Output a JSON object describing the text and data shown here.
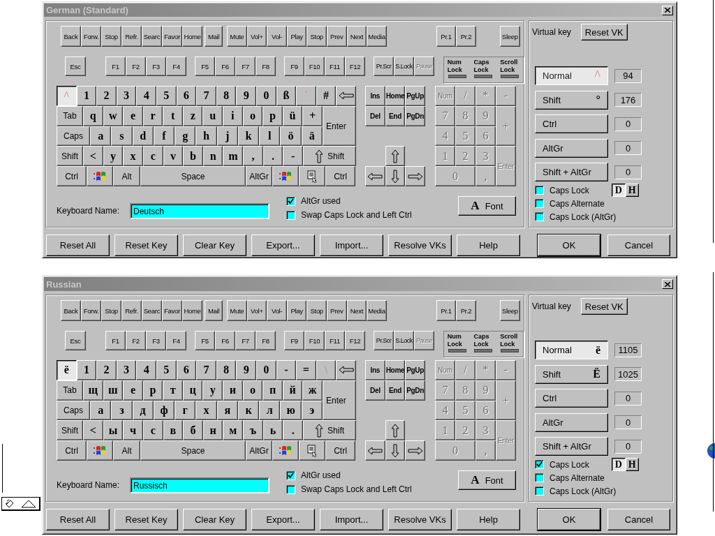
{
  "windows": [
    {
      "title": "German (Standard)",
      "media_keys": [
        [
          "Back",
          "Forw.",
          "Stop",
          "Refr.",
          "Searc",
          "Favor",
          "Home"
        ],
        [
          "Mail"
        ],
        [
          "Mute",
          "Vol+",
          "Vol-",
          "Play",
          "Stop",
          "Prev",
          "Next",
          "Media"
        ],
        [
          "Pr.1",
          "Pr.2"
        ],
        [
          "Sleep"
        ]
      ],
      "function_keys": [
        [
          "Esc"
        ],
        [
          "F1",
          "F2",
          "F3",
          "F4"
        ],
        [
          "F5",
          "F6",
          "F7",
          "F8"
        ],
        [
          "F9",
          "F10",
          "F11",
          "F12"
        ]
      ],
      "system_keys": [
        {
          "label": "Pr.Scr",
          "disabled": false
        },
        {
          "label": "S.Lock",
          "disabled": false
        },
        {
          "label": "Pause",
          "disabled": true
        }
      ],
      "lock_lights": [
        {
          "label": "Num Lock",
          "on": false
        },
        {
          "label": "Caps Lock",
          "on": false
        },
        {
          "label": "Scroll Lock",
          "on": false
        }
      ],
      "main_rows": [
        [
          {
            "label": "^",
            "kind": "dead",
            "selected": true
          },
          {
            "label": "1",
            "kind": "char",
            "selected": false
          },
          {
            "label": "2",
            "kind": "char",
            "selected": false
          },
          {
            "label": "3",
            "kind": "char",
            "selected": false
          },
          {
            "label": "4",
            "kind": "char",
            "selected": false
          },
          {
            "label": "5",
            "kind": "char",
            "selected": false
          },
          {
            "label": "6",
            "kind": "char",
            "selected": false
          },
          {
            "label": "7",
            "kind": "char",
            "selected": false
          },
          {
            "label": "8",
            "kind": "char",
            "selected": false
          },
          {
            "label": "9",
            "kind": "char",
            "selected": false
          },
          {
            "label": "0",
            "kind": "char",
            "selected": false
          },
          {
            "label": "ß",
            "kind": "char",
            "selected": false
          },
          {
            "label": "´",
            "kind": "dead",
            "selected": false
          },
          {
            "label": "#",
            "kind": "char",
            "selected": false
          },
          {
            "kind": "backspace",
            "selected": false
          }
        ],
        [
          {
            "label": "Tab",
            "kind": "tab",
            "selected": false
          },
          {
            "label": "q",
            "kind": "char",
            "selected": false
          },
          {
            "label": "w",
            "kind": "char",
            "selected": false
          },
          {
            "label": "e",
            "kind": "char",
            "selected": false
          },
          {
            "label": "r",
            "kind": "char",
            "selected": false
          },
          {
            "label": "t",
            "kind": "char",
            "selected": false
          },
          {
            "label": "z",
            "kind": "char",
            "selected": false
          },
          {
            "label": "u",
            "kind": "char",
            "selected": false
          },
          {
            "label": "i",
            "kind": "char",
            "selected": false
          },
          {
            "label": "o",
            "kind": "char",
            "selected": false
          },
          {
            "label": "p",
            "kind": "char",
            "selected": false
          },
          {
            "label": "ü",
            "kind": "char",
            "selected": false
          },
          {
            "label": "+",
            "kind": "char",
            "selected": false
          },
          {
            "label": "Enter",
            "kind": "enter",
            "selected": false
          }
        ],
        [
          {
            "label": "Caps",
            "kind": "caps",
            "selected": false
          },
          {
            "label": "a",
            "kind": "char",
            "selected": false
          },
          {
            "label": "s",
            "kind": "char",
            "selected": false
          },
          {
            "label": "d",
            "kind": "char",
            "selected": false
          },
          {
            "label": "f",
            "kind": "char",
            "selected": false
          },
          {
            "label": "g",
            "kind": "char",
            "selected": false
          },
          {
            "label": "h",
            "kind": "char",
            "selected": false
          },
          {
            "label": "j",
            "kind": "char",
            "selected": false
          },
          {
            "label": "k",
            "kind": "char",
            "selected": false
          },
          {
            "label": "l",
            "kind": "char",
            "selected": false
          },
          {
            "label": "ö",
            "kind": "char",
            "selected": false
          },
          {
            "label": "ä",
            "kind": "char",
            "selected": false
          }
        ],
        [
          {
            "label": "Shift",
            "kind": "shift",
            "selected": false
          },
          {
            "label": "<",
            "kind": "char",
            "selected": false
          },
          {
            "label": "y",
            "kind": "char",
            "selected": false
          },
          {
            "label": "x",
            "kind": "char",
            "selected": false
          },
          {
            "label": "c",
            "kind": "char",
            "selected": false
          },
          {
            "label": "v",
            "kind": "char",
            "selected": false
          },
          {
            "label": "b",
            "kind": "char",
            "selected": false
          },
          {
            "label": "n",
            "kind": "char",
            "selected": false
          },
          {
            "label": "m",
            "kind": "char",
            "selected": false
          },
          {
            "label": ",",
            "kind": "char",
            "selected": false
          },
          {
            "label": ".",
            "kind": "char",
            "selected": false
          },
          {
            "label": "-",
            "kind": "char",
            "selected": false
          },
          {
            "label": "Shift",
            "kind": "rshift",
            "selected": false
          }
        ],
        [
          {
            "label": "Ctrl",
            "kind": "ctrl",
            "selected": false
          },
          {
            "kind": "win",
            "selected": false
          },
          {
            "label": "Alt",
            "kind": "alt",
            "selected": false
          },
          {
            "label": "Space",
            "kind": "space",
            "selected": false
          },
          {
            "label": "AltGr",
            "kind": "altgr",
            "selected": false
          },
          {
            "kind": "win",
            "selected": false
          },
          {
            "kind": "menu",
            "selected": false
          },
          {
            "label": "Ctrl",
            "kind": "ctrl",
            "selected": false
          }
        ]
      ],
      "nav_keys": [
        "Ins",
        "Home",
        "PgUp",
        "Del",
        "End",
        "PgDn"
      ],
      "numpad": {
        "disabled": true,
        "keys": [
          "Num",
          "/",
          "*",
          "-",
          "7",
          "8",
          "9",
          "+",
          "4",
          "5",
          "6",
          "1",
          "2",
          "3",
          "Enter",
          "0",
          ","
        ]
      },
      "keyboard_name": {
        "label": "Keyboard Name:",
        "value": "Deutsch"
      },
      "options": [
        {
          "label": "AltGr used",
          "checked": true
        },
        {
          "label": "Swap Caps Lock and Left Ctrl",
          "checked": false
        }
      ],
      "font_button": {
        "icon": "A",
        "label": "Font"
      },
      "virtual_key": {
        "label": "Virtual key",
        "button": "Reset VK"
      },
      "shift_states": [
        {
          "label": "Normal",
          "char": "^",
          "code": "94",
          "selected": true,
          "dead": true
        },
        {
          "label": "Shift",
          "char": "°",
          "code": "176",
          "selected": false,
          "dead": false
        },
        {
          "label": "Ctrl",
          "code": "0",
          "selected": false
        },
        {
          "label": "AltGr",
          "code": "0",
          "selected": false
        },
        {
          "label": "Shift + AltGr",
          "code": "0",
          "selected": false
        }
      ],
      "caps_options": [
        {
          "label": "Caps Lock",
          "checked": false
        },
        {
          "label": "Caps Alternate",
          "checked": false
        },
        {
          "label": "Caps Lock (AltGr)",
          "checked": false
        }
      ],
      "display_toggle": [
        {
          "label": "D",
          "selected": true
        },
        {
          "label": "H",
          "selected": false
        }
      ],
      "buttons": [
        {
          "label": "Reset All",
          "default": false
        },
        {
          "label": "Reset Key",
          "default": false
        },
        {
          "label": "Clear Key",
          "default": false
        },
        {
          "label": "Export...",
          "default": false
        },
        {
          "label": "Import...",
          "default": false
        },
        {
          "label": "Resolve VKs",
          "default": false
        },
        {
          "label": "Help",
          "default": false
        }
      ],
      "dialog_buttons": [
        {
          "label": "OK",
          "default": true
        },
        {
          "label": "Cancel",
          "default": false
        }
      ]
    },
    {
      "title": "Russian",
      "media_keys": [
        [
          "Back",
          "Forw.",
          "Stop",
          "Refr.",
          "Searc",
          "Favor",
          "Home"
        ],
        [
          "Mail"
        ],
        [
          "Mute",
          "Vol+",
          "Vol-",
          "Play",
          "Stop",
          "Prev",
          "Next",
          "Media"
        ],
        [
          "Pr.1",
          "Pr.2"
        ],
        [
          "Sleep"
        ]
      ],
      "function_keys": [
        [
          "Esc"
        ],
        [
          "F1",
          "F2",
          "F3",
          "F4"
        ],
        [
          "F5",
          "F6",
          "F7",
          "F8"
        ],
        [
          "F9",
          "F10",
          "F11",
          "F12"
        ]
      ],
      "system_keys": [
        {
          "label": "Pr.Scr",
          "disabled": false
        },
        {
          "label": "S.Lock",
          "disabled": false
        },
        {
          "label": "Pause",
          "disabled": true
        }
      ],
      "lock_lights": [
        {
          "label": "Num Lock",
          "on": false
        },
        {
          "label": "Caps Lock",
          "on": false
        },
        {
          "label": "Scroll Lock",
          "on": false
        }
      ],
      "main_rows": [
        [
          {
            "label": "ё",
            "kind": "char",
            "selected": true
          },
          {
            "label": "1",
            "kind": "char",
            "selected": false
          },
          {
            "label": "2",
            "kind": "char",
            "selected": false
          },
          {
            "label": "3",
            "kind": "char",
            "selected": false
          },
          {
            "label": "4",
            "kind": "char",
            "selected": false
          },
          {
            "label": "5",
            "kind": "char",
            "selected": false
          },
          {
            "label": "6",
            "kind": "char",
            "selected": false
          },
          {
            "label": "7",
            "kind": "char",
            "selected": false
          },
          {
            "label": "8",
            "kind": "char",
            "selected": false
          },
          {
            "label": "9",
            "kind": "char",
            "selected": false
          },
          {
            "label": "0",
            "kind": "char",
            "selected": false
          },
          {
            "label": "-",
            "kind": "char",
            "selected": false
          },
          {
            "label": "=",
            "kind": "char",
            "selected": false
          },
          {
            "label": "\\",
            "kind": "dim",
            "selected": false
          },
          {
            "kind": "backspace",
            "selected": false
          }
        ],
        [
          {
            "label": "Tab",
            "kind": "tab",
            "selected": false
          },
          {
            "label": "щ",
            "kind": "char",
            "selected": false
          },
          {
            "label": "ш",
            "kind": "char",
            "selected": false
          },
          {
            "label": "е",
            "kind": "char",
            "selected": false
          },
          {
            "label": "р",
            "kind": "char",
            "selected": false
          },
          {
            "label": "т",
            "kind": "char",
            "selected": false
          },
          {
            "label": "ц",
            "kind": "char",
            "selected": false
          },
          {
            "label": "у",
            "kind": "char",
            "selected": false
          },
          {
            "label": "и",
            "kind": "char",
            "selected": false
          },
          {
            "label": "о",
            "kind": "char",
            "selected": false
          },
          {
            "label": "п",
            "kind": "char",
            "selected": false
          },
          {
            "label": "й",
            "kind": "char",
            "selected": false
          },
          {
            "label": "ж",
            "kind": "char",
            "selected": false
          },
          {
            "label": "Enter",
            "kind": "enter",
            "selected": false
          }
        ],
        [
          {
            "label": "Caps",
            "kind": "caps",
            "selected": false
          },
          {
            "label": "а",
            "kind": "char",
            "selected": false
          },
          {
            "label": "з",
            "kind": "char",
            "selected": false
          },
          {
            "label": "д",
            "kind": "char",
            "selected": false
          },
          {
            "label": "ф",
            "kind": "char",
            "selected": false
          },
          {
            "label": "г",
            "kind": "char",
            "selected": false
          },
          {
            "label": "х",
            "kind": "char",
            "selected": false
          },
          {
            "label": "я",
            "kind": "char",
            "selected": false
          },
          {
            "label": "к",
            "kind": "char",
            "selected": false
          },
          {
            "label": "л",
            "kind": "char",
            "selected": false
          },
          {
            "label": "ю",
            "kind": "char",
            "selected": false
          },
          {
            "label": "э",
            "kind": "char",
            "selected": false
          }
        ],
        [
          {
            "label": "Shift",
            "kind": "shift",
            "selected": false
          },
          {
            "label": "<",
            "kind": "char",
            "selected": false
          },
          {
            "label": "ы",
            "kind": "char",
            "selected": false
          },
          {
            "label": "ч",
            "kind": "char",
            "selected": false
          },
          {
            "label": "с",
            "kind": "char",
            "selected": false
          },
          {
            "label": "в",
            "kind": "char",
            "selected": false
          },
          {
            "label": "б",
            "kind": "char",
            "selected": false
          },
          {
            "label": "н",
            "kind": "char",
            "selected": false
          },
          {
            "label": "м",
            "kind": "char",
            "selected": false
          },
          {
            "label": "ъ",
            "kind": "char",
            "selected": false
          },
          {
            "label": "ь",
            "kind": "char",
            "selected": false
          },
          {
            "label": ".",
            "kind": "char",
            "selected": false
          },
          {
            "label": "Shift",
            "kind": "rshift",
            "selected": false
          }
        ],
        [
          {
            "label": "Ctrl",
            "kind": "ctrl",
            "selected": false
          },
          {
            "kind": "win",
            "selected": false
          },
          {
            "label": "Alt",
            "kind": "alt",
            "selected": false
          },
          {
            "label": "Space",
            "kind": "space",
            "selected": false
          },
          {
            "label": "AltGr",
            "kind": "altgr",
            "selected": false
          },
          {
            "kind": "win",
            "selected": false
          },
          {
            "kind": "menu",
            "selected": false
          },
          {
            "label": "Ctrl",
            "kind": "ctrl",
            "selected": false
          }
        ]
      ],
      "nav_keys": [
        "Ins",
        "Home",
        "PgUp",
        "Del",
        "End",
        "PgDn"
      ],
      "numpad": {
        "disabled": true,
        "keys": [
          "Num",
          "/",
          "*",
          "-",
          "7",
          "8",
          "9",
          "+",
          "4",
          "5",
          "6",
          "1",
          "2",
          "3",
          "Enter",
          "0",
          ","
        ]
      },
      "keyboard_name": {
        "label": "Keyboard Name:",
        "value": "Russisch"
      },
      "options": [
        {
          "label": "AltGr used",
          "checked": true
        },
        {
          "label": "Swap Caps Lock and Left Ctrl",
          "checked": false
        }
      ],
      "font_button": {
        "icon": "A",
        "label": "Font"
      },
      "virtual_key": {
        "label": "Virtual key",
        "button": "Reset VK"
      },
      "shift_states": [
        {
          "label": "Normal",
          "char": "ё",
          "code": "1105",
          "selected": true,
          "dead": false
        },
        {
          "label": "Shift",
          "char": "Ё",
          "code": "1025",
          "selected": false,
          "dead": false
        },
        {
          "label": "Ctrl",
          "code": "0",
          "selected": false
        },
        {
          "label": "AltGr",
          "code": "0",
          "selected": false
        },
        {
          "label": "Shift + AltGr",
          "code": "0",
          "selected": false
        }
      ],
      "caps_options": [
        {
          "label": "Caps Lock",
          "checked": true
        },
        {
          "label": "Caps Alternate",
          "checked": false
        },
        {
          "label": "Caps Lock (AltGr)",
          "checked": false
        }
      ],
      "display_toggle": [
        {
          "label": "D",
          "selected": true
        },
        {
          "label": "H",
          "selected": false
        }
      ],
      "buttons": [
        {
          "label": "Reset All",
          "default": false
        },
        {
          "label": "Reset Key",
          "default": false
        },
        {
          "label": "Clear Key",
          "default": false
        },
        {
          "label": "Export...",
          "default": false
        },
        {
          "label": "Import...",
          "default": false
        },
        {
          "label": "Resolve VKs",
          "default": false
        },
        {
          "label": "Help",
          "default": false
        }
      ],
      "dialog_buttons": [
        {
          "label": "OK",
          "default": true
        },
        {
          "label": "Cancel",
          "default": false
        }
      ]
    }
  ]
}
